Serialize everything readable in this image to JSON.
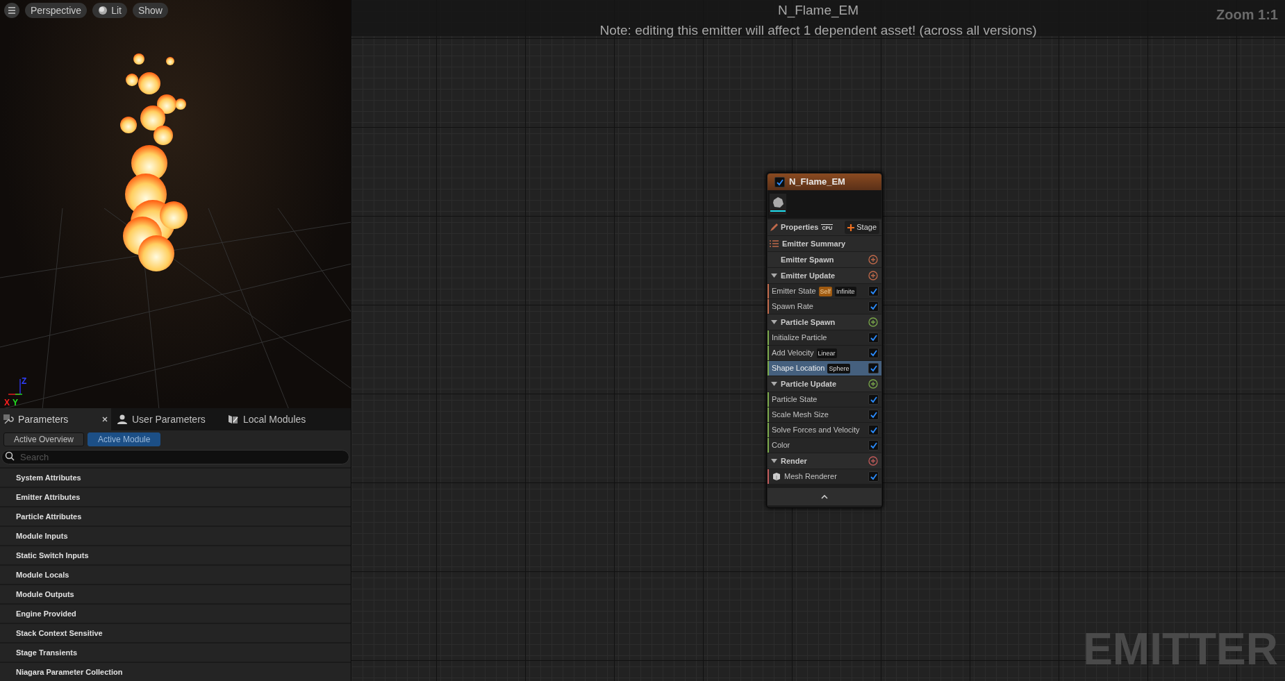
{
  "viewport": {
    "toolbar": [
      {
        "kind": "menu"
      },
      {
        "kind": "text",
        "label": "Perspective"
      },
      {
        "kind": "lit",
        "label": "Lit"
      },
      {
        "kind": "text",
        "label": "Show"
      }
    ],
    "axes": {
      "z": "Z",
      "x": "X",
      "y": "Y"
    }
  },
  "panel": {
    "tabs": [
      {
        "label": "Parameters",
        "selected": true,
        "closable": true
      },
      {
        "label": "User Parameters",
        "selected": false,
        "closable": false
      },
      {
        "label": "Local Modules",
        "selected": false,
        "closable": false
      }
    ],
    "filters": [
      {
        "label": "Active Overview",
        "selected": false
      },
      {
        "label": "Active Module",
        "selected": true
      }
    ],
    "search": {
      "placeholder": "Search"
    },
    "categories": [
      "System Attributes",
      "Emitter Attributes",
      "Particle Attributes",
      "Module Inputs",
      "Static Switch Inputs",
      "Module Locals",
      "Module Outputs",
      "Engine Provided",
      "Stack Context Sensitive",
      "Stage Transients",
      "Niagara Parameter Collection"
    ]
  },
  "graph": {
    "title": "N_Flame_EM",
    "note": "Note: editing this emitter will affect 1 dependent asset! (across all versions)",
    "zoom": "Zoom 1:1",
    "watermark": "EMITTER",
    "node": {
      "title": "N_Flame_EM",
      "enabled": true,
      "properties": "Properties",
      "cpu": "CPU",
      "stage": "Stage",
      "summary": "Emitter Summary",
      "sections": [
        {
          "title": "Emitter Spawn",
          "color": "#c0694a"
        },
        {
          "title": "Emitter Update",
          "color": "#c0694a",
          "expanded": true,
          "items": [
            {
              "label": "Emitter State",
              "tags": [
                {
                  "text": "Self",
                  "kind": "highlight"
                },
                {
                  "text": "Infinite",
                  "kind": "plain"
                }
              ],
              "checked": true,
              "selected": false
            },
            {
              "label": "Spawn Rate",
              "checked": true,
              "selected": false
            }
          ]
        },
        {
          "title": "Particle Spawn",
          "color": "#7aa84a",
          "expanded": true,
          "items": [
            {
              "label": "Initialize Particle",
              "checked": true,
              "selected": false
            },
            {
              "label": "Add Velocity",
              "tags": [
                {
                  "text": "Linear",
                  "kind": "plain"
                }
              ],
              "checked": true,
              "selected": false
            },
            {
              "label": "Shape Location",
              "tags": [
                {
                  "text": "Sphere",
                  "kind": "plain"
                }
              ],
              "checked": true,
              "selected": true
            }
          ]
        },
        {
          "title": "Particle Update",
          "color": "#7aa84a",
          "expanded": true,
          "items": [
            {
              "label": "Particle State",
              "checked": true,
              "selected": false
            },
            {
              "label": "Scale Mesh Size",
              "checked": true,
              "selected": false
            },
            {
              "label": "Solve Forces and Velocity",
              "checked": true,
              "selected": false
            },
            {
              "label": "Color",
              "checked": true,
              "selected": false
            }
          ]
        },
        {
          "title": "Render",
          "color": "#c05a5a",
          "expanded": true,
          "items": [
            {
              "label": "Mesh Renderer",
              "checked": true,
              "selected": false,
              "kind": "renderer"
            }
          ]
        }
      ]
    }
  }
}
